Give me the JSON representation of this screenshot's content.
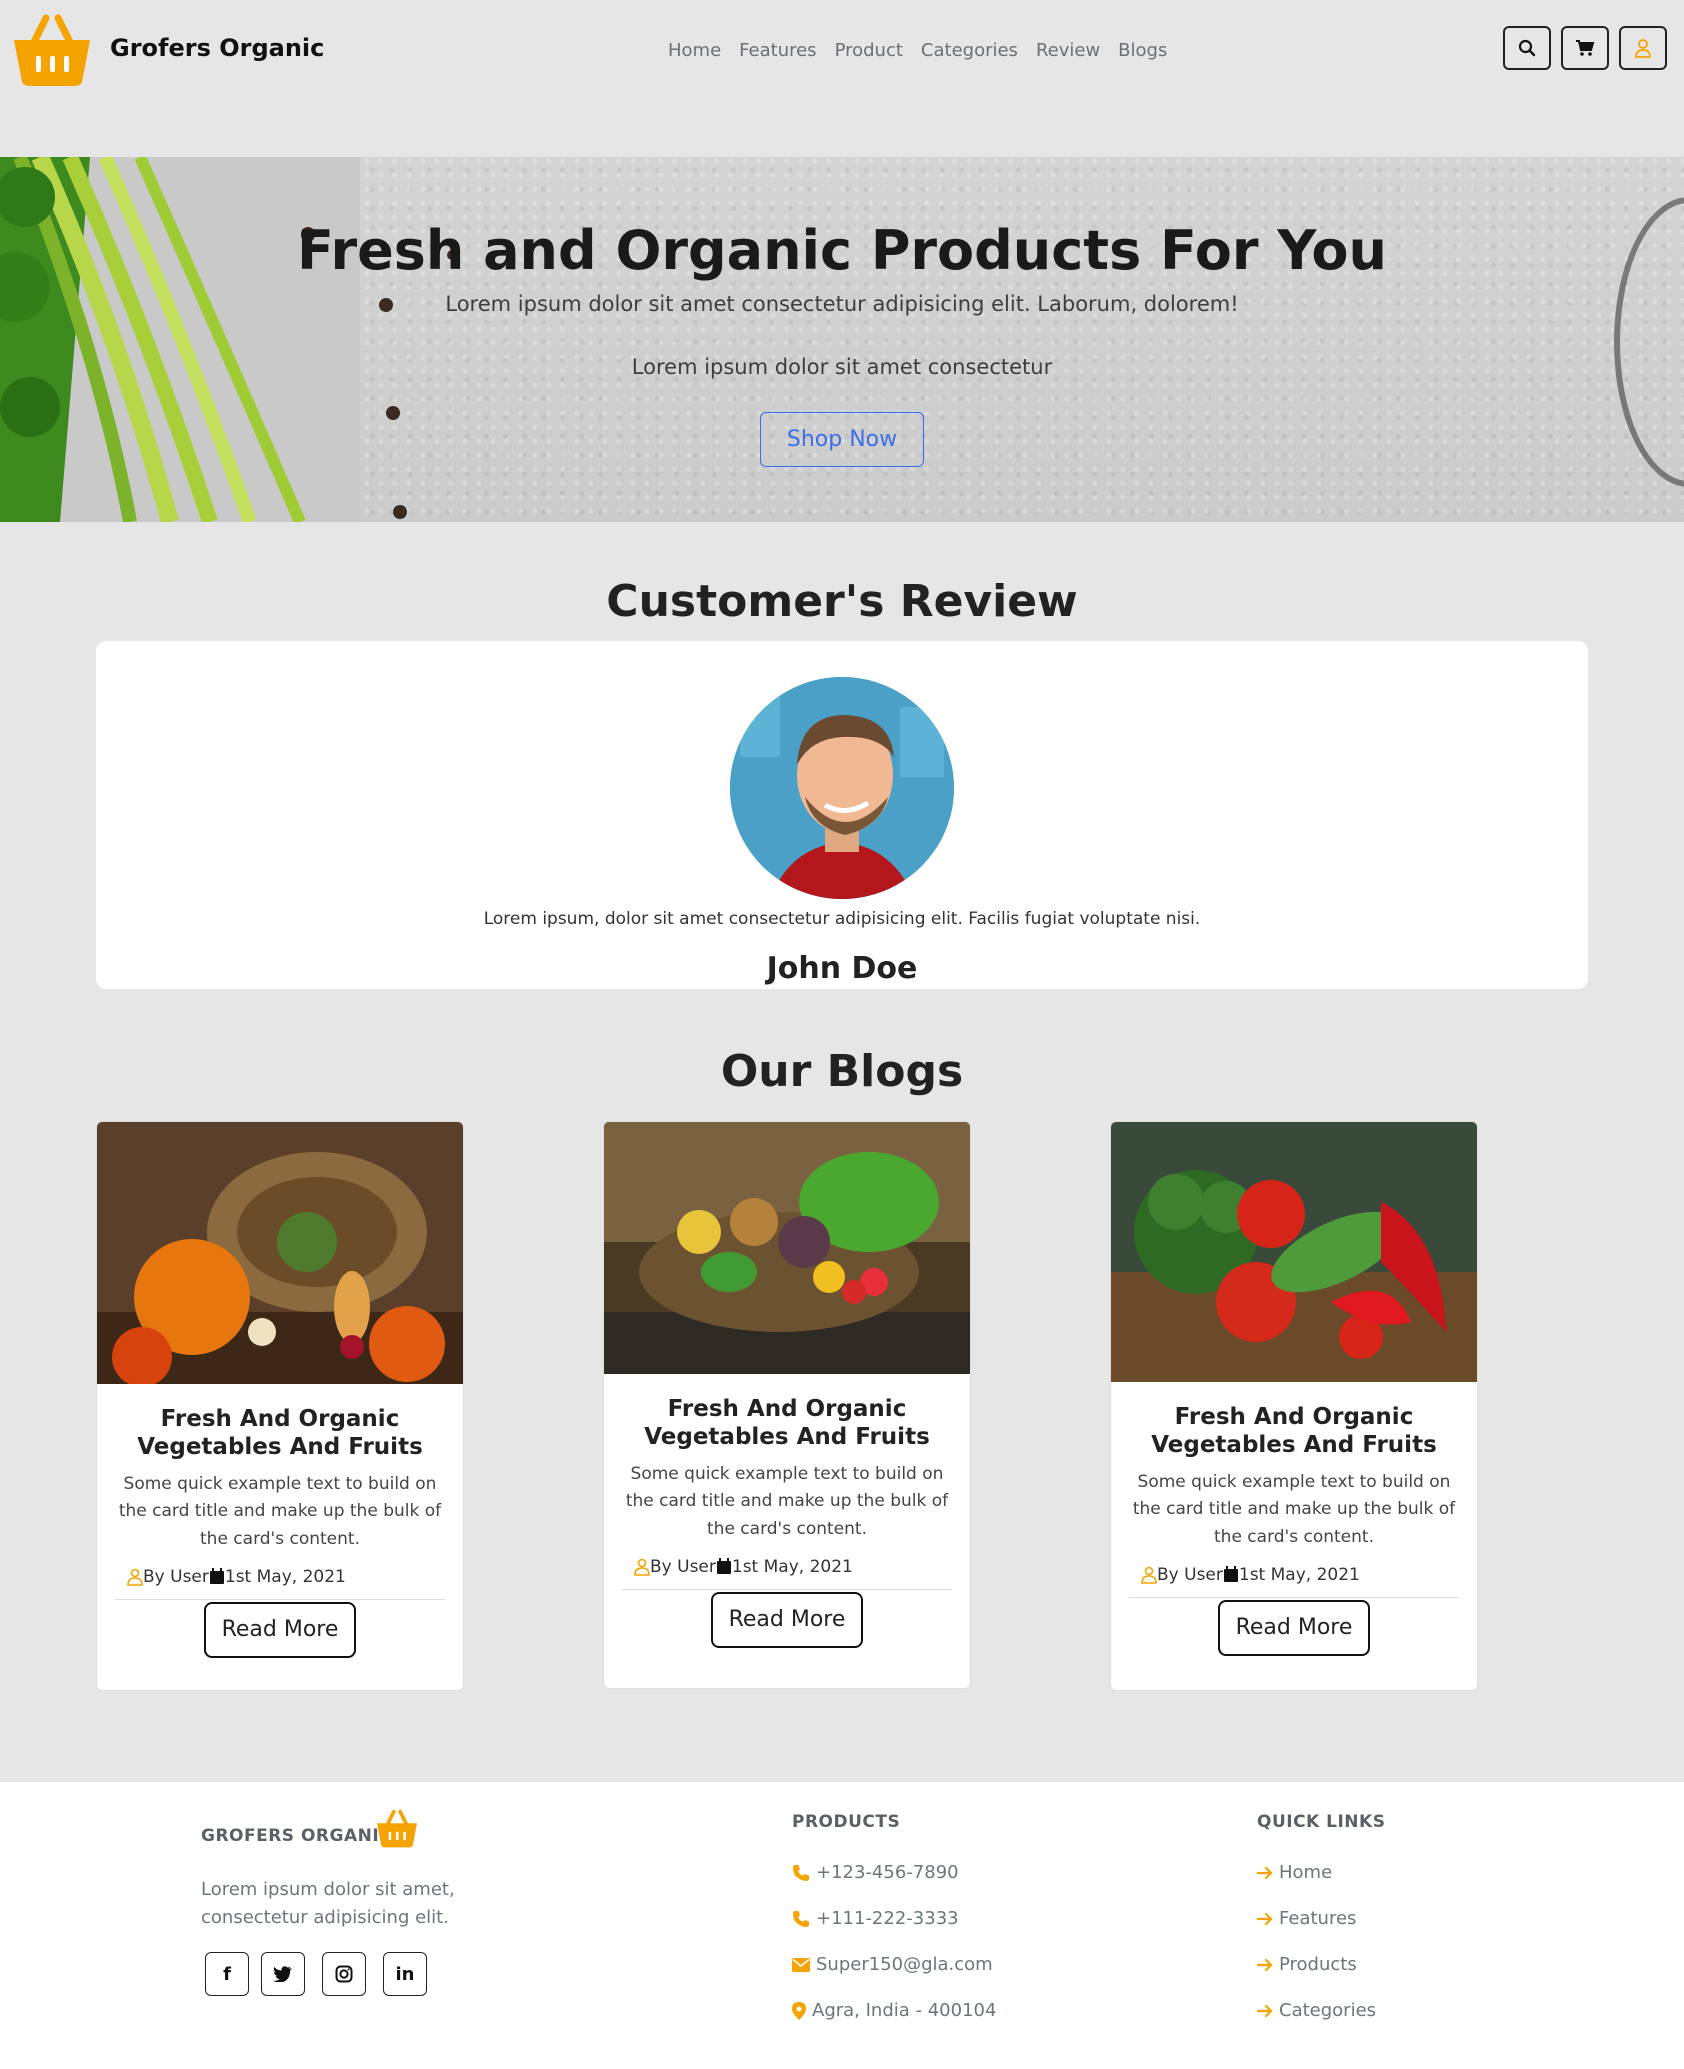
{
  "header": {
    "brand": "Grofers Organic",
    "nav": [
      "Home",
      "Features",
      "Product",
      "Categories",
      "Review",
      "Blogs"
    ],
    "accent_color": "#f5a300",
    "icons": [
      "search-icon",
      "cart-icon",
      "user-icon"
    ]
  },
  "hero": {
    "title": "Fresh and Organic Products For You",
    "subtitle1": "Lorem ipsum dolor sit amet consectetur adipisicing elit. Laborum, dolorem!",
    "subtitle2": "Lorem ipsum dolor sit amet consectetur",
    "cta": "Shop Now",
    "cta_color": "#3b6ee8"
  },
  "review": {
    "section_title": "Customer's Review",
    "text": "Lorem ipsum, dolor sit amet consectetur adipisicing elit. Facilis fugiat voluptate nisi.",
    "name": "John Doe"
  },
  "blogs": {
    "section_title": "Our Blogs",
    "cards": [
      {
        "title": "Fresh And Organic Vegetables And Fruits",
        "text": "Some quick example text to build on the card title and make up the bulk of the card's content.",
        "author": "By User",
        "date": "1st May, 2021",
        "button": "Read More"
      },
      {
        "title": "Fresh And Organic Vegetables And Fruits",
        "text": "Some quick example text to build on the card title and make up the bulk of the card's content.",
        "author": "By User",
        "date": "1st May, 2021",
        "button": "Read More"
      },
      {
        "title": "Fresh And Organic Vegetables And Fruits",
        "text": "Some quick example text to build on the card title and make up the bulk of the card's content.",
        "author": "By User",
        "date": "1st May, 2021",
        "button": "Read More"
      }
    ]
  },
  "footer": {
    "brand": "GROFERS ORGANIC",
    "about": "Lorem ipsum dolor sit amet, consectetur adipisicing elit.",
    "social": [
      "f",
      "in"
    ],
    "products_heading": "PRODUCTS",
    "contacts": [
      "+123-456-7890",
      "+111-222-3333",
      "Super150@gla.com",
      "Agra, India - 400104"
    ],
    "quick_links_heading": "QUICK LINKS",
    "quick_links": [
      "Home",
      "Features",
      "Products",
      "Categories"
    ]
  }
}
